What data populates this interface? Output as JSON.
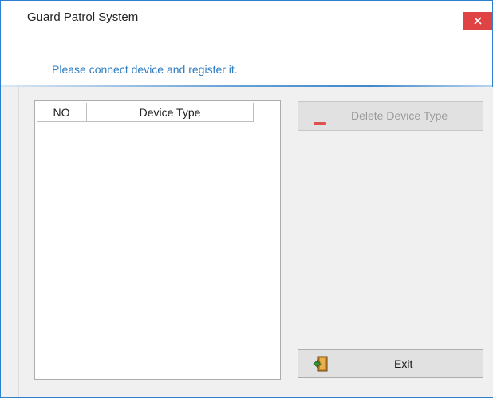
{
  "window": {
    "title": "Guard Patrol System",
    "close_icon": "close-icon",
    "close_color": "#e04343"
  },
  "header": {
    "instruction": "Please connect device and register it."
  },
  "device_list": {
    "columns": [
      "NO",
      "Device Type"
    ],
    "rows": []
  },
  "buttons": {
    "delete_label": "Delete Device Type",
    "delete_icon": "minus-icon",
    "delete_enabled": false,
    "exit_label": "Exit",
    "exit_icon": "exit-door-icon"
  },
  "colors": {
    "accent": "#2f7cc0",
    "delete_icon": "#e05050"
  }
}
